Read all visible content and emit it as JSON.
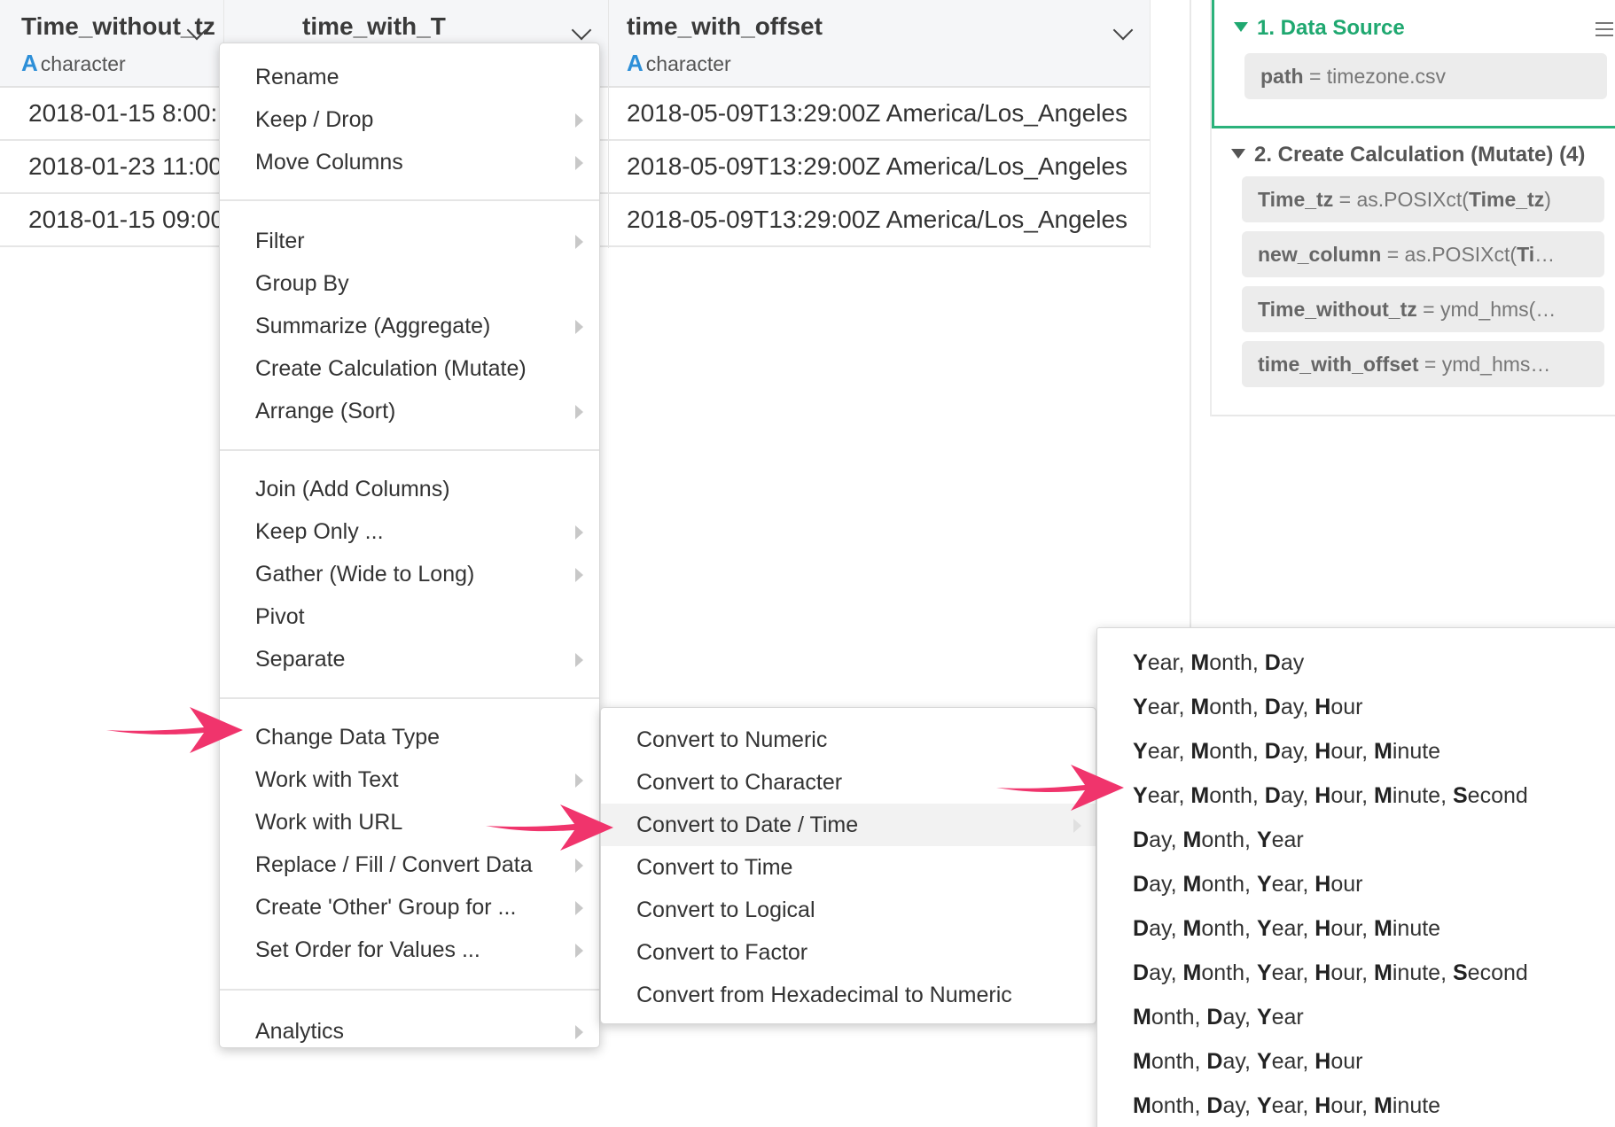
{
  "grid": {
    "columns": [
      {
        "name": "Time_without_tz",
        "type_icon": "A",
        "type": "character",
        "cells": [
          "2018-01-15 8:00:",
          "2018-01-23 11:00",
          "2018-01-15 09:00"
        ]
      },
      {
        "name": "time_with_T",
        "type_icon": "",
        "type": "",
        "cells": [
          "",
          "",
          ""
        ]
      },
      {
        "name": "time_with_offset",
        "type_icon": "A",
        "type": "character",
        "cells": [
          "2018-05-09T13:29:00Z America/Los_Angeles",
          "2018-05-09T13:29:00Z America/Los_Angeles",
          "2018-05-09T13:29:00Z America/Los_Angeles"
        ]
      }
    ]
  },
  "pipeline": {
    "step1": {
      "title": "1. Data Source",
      "params": [
        {
          "key": "path",
          "op": " = ",
          "value": "timezone.csv"
        }
      ]
    },
    "step2": {
      "title": "2. Create Calculation (Mutate) (4)",
      "params": [
        {
          "key": "Time_tz",
          "op": " = ",
          "value": "as.POSIXct(",
          "bold_tail": "Time_tz",
          "tail": ")"
        },
        {
          "key": "new_column",
          "op": " = ",
          "value": "as.POSIXct(",
          "bold_tail": "Ti",
          "tail": "…"
        },
        {
          "key": "Time_without_tz",
          "op": " = ",
          "value": "ymd_hms(…",
          "bold_tail": "",
          "tail": ""
        },
        {
          "key": "time_with_offset",
          "op": " = ",
          "value": "ymd_hms…",
          "bold_tail": "",
          "tail": ""
        }
      ]
    },
    "accent_color": "#2bb27b"
  },
  "column_menu": {
    "groups": [
      [
        {
          "label": "Rename",
          "submenu": false
        },
        {
          "label": "Keep / Drop",
          "submenu": true
        },
        {
          "label": "Move Columns",
          "submenu": true
        }
      ],
      [
        {
          "label": "Filter",
          "submenu": true
        },
        {
          "label": "Group By",
          "submenu": false
        },
        {
          "label": "Summarize (Aggregate)",
          "submenu": true
        },
        {
          "label": "Create Calculation (Mutate)",
          "submenu": false
        },
        {
          "label": "Arrange (Sort)",
          "submenu": true
        }
      ],
      [
        {
          "label": "Join (Add Columns)",
          "submenu": false
        },
        {
          "label": "Keep Only ...",
          "submenu": true
        },
        {
          "label": "Gather (Wide to Long)",
          "submenu": true
        },
        {
          "label": "Pivot",
          "submenu": false
        },
        {
          "label": "Separate",
          "submenu": true
        }
      ],
      [
        {
          "label": "Change Data Type",
          "submenu": false
        },
        {
          "label": "Work with Text",
          "submenu": true
        },
        {
          "label": "Work with URL",
          "submenu": false
        },
        {
          "label": "Replace / Fill / Convert Data",
          "submenu": true
        },
        {
          "label": "Create 'Other' Group for ...",
          "submenu": true
        },
        {
          "label": "Set Order for Values ...",
          "submenu": true
        }
      ],
      [
        {
          "label": "Analytics",
          "submenu": true
        }
      ]
    ]
  },
  "type_menu": {
    "items": [
      {
        "label": "Convert to Numeric"
      },
      {
        "label": "Convert to Character"
      },
      {
        "label": "Convert to Date / Time",
        "highlighted": true
      },
      {
        "label": "Convert to Time"
      },
      {
        "label": "Convert to Logical"
      },
      {
        "label": "Convert to Factor"
      },
      {
        "label": "Convert from Hexadecimal to Numeric"
      }
    ]
  },
  "date_menu": {
    "items": [
      "Year, Month, Day",
      "Year, Month, Day, Hour",
      "Year, Month, Day, Hour, Minute",
      "Year, Month, Day, Hour, Minute, Second",
      "Day, Month, Year",
      "Day, Month, Year, Hour",
      "Day, Month, Year, Hour, Minute",
      "Day, Month, Year, Hour, Minute, Second",
      "Month, Day, Year",
      "Month, Day, Year, Hour",
      "Month, Day, Year, Hour, Minute"
    ]
  },
  "annotation": {
    "arrow_color": "#f0346c"
  }
}
